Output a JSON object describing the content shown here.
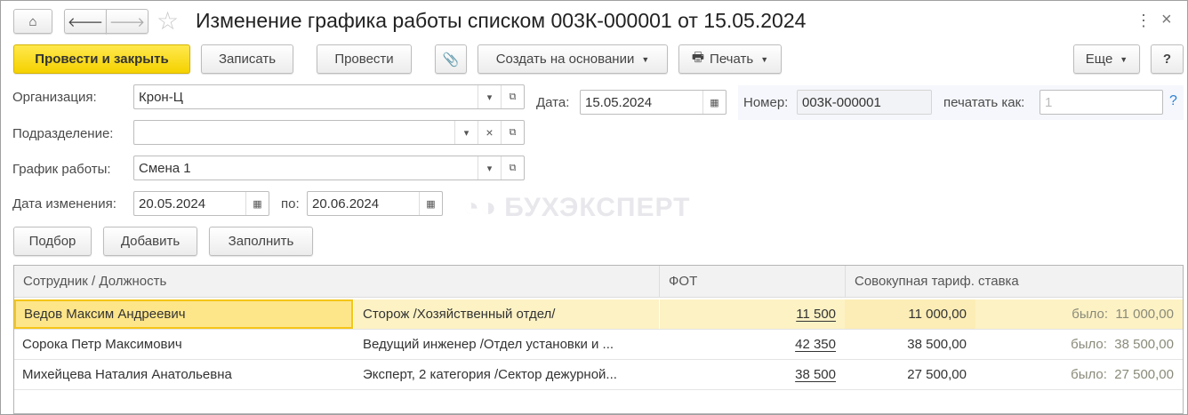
{
  "title": "Изменение графика работы списком 003К-000001 от 15.05.2024",
  "toolbar": {
    "post_close": "Провести и закрыть",
    "save": "Записать",
    "post": "Провести",
    "create_based": "Создать на основании",
    "print": "Печать",
    "more": "Еще",
    "help": "?"
  },
  "form": {
    "org_label": "Организация:",
    "org_value": "Крон-Ц",
    "dept_label": "Подразделение:",
    "dept_value": "",
    "schedule_label": "График работы:",
    "schedule_value": "Смена 1",
    "change_date_label": "Дата изменения:",
    "change_date_value": "20.05.2024",
    "to_label": "по:",
    "to_value": "20.06.2024",
    "date_label": "Дата:",
    "date_value": "15.05.2024",
    "number_label": "Номер:",
    "number_value": "003К-000001",
    "print_as_label": "печатать как:",
    "print_as_placeholder": "1",
    "help": "?"
  },
  "watermark": "БУХЭКСПЕРТ",
  "table_buttons": {
    "pick": "Подбор",
    "add": "Добавить",
    "fill": "Заполнить"
  },
  "table": {
    "headers": {
      "employee": "Сотрудник / Должность",
      "fot": "ФОТ",
      "rate": "Совокупная тариф. ставка"
    },
    "rows": [
      {
        "name": "Ведов Максим Андреевич",
        "position": "Сторож /Хозяйственный отдел/",
        "fot": "11 500",
        "rate": "11 000,00",
        "was": "было:  11 000,00"
      },
      {
        "name": "Сорока Петр Максимович",
        "position": "Ведущий инженер /Отдел установки и ...",
        "fot": "42 350",
        "rate": "38 500,00",
        "was": "было:  38 500,00"
      },
      {
        "name": "Михейцева Наталия Анатольевна",
        "position": "Эксперт, 2 категория /Сектор дежурной...",
        "fot": "38 500",
        "rate": "27 500,00",
        "was": "было:  27 500,00"
      }
    ]
  }
}
